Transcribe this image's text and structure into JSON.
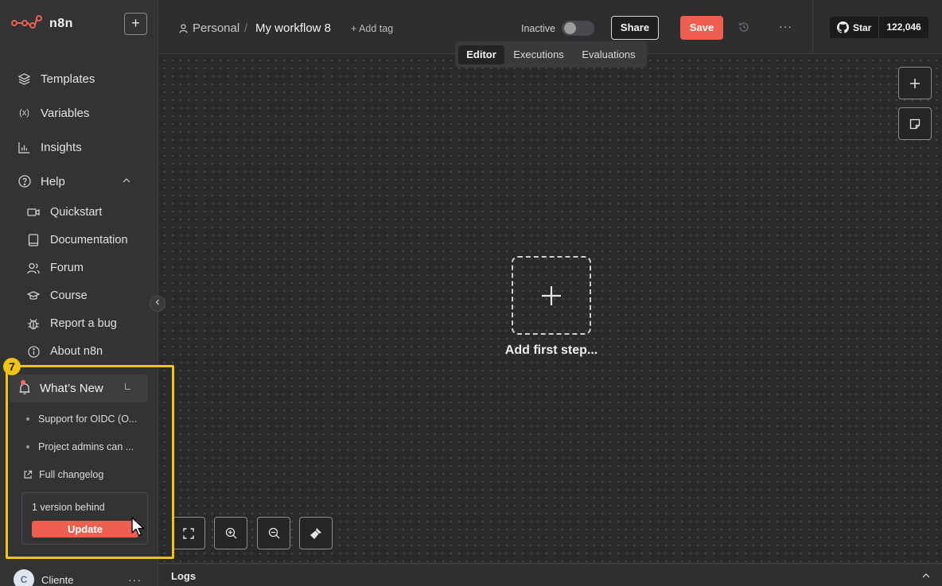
{
  "app": {
    "name": "n8n",
    "accent": "#ef5f4f"
  },
  "sidebar": {
    "add_label": "+",
    "nav": [
      {
        "label": "Templates",
        "icon": "templates-icon"
      },
      {
        "label": "Variables",
        "icon": "variables-icon"
      },
      {
        "label": "Insights",
        "icon": "insights-icon"
      },
      {
        "label": "Help",
        "icon": "help-icon"
      }
    ],
    "help_items": [
      {
        "label": "Quickstart",
        "icon": "video-icon"
      },
      {
        "label": "Documentation",
        "icon": "book-icon"
      },
      {
        "label": "Forum",
        "icon": "users-icon"
      },
      {
        "label": "Course",
        "icon": "graduation-cap-icon"
      },
      {
        "label": "Report a bug",
        "icon": "bug-icon"
      },
      {
        "label": "About n8n",
        "icon": "info-icon"
      }
    ],
    "whats_new": {
      "badge": "7",
      "title": "What’s New",
      "items": [
        "Support for OIDC (O...",
        "Project admins can ..."
      ],
      "changelog_label": "Full changelog",
      "version_text": "1 version behind",
      "update_label": "Update"
    },
    "user": {
      "initial": "C",
      "name": "Cliente"
    }
  },
  "header": {
    "project": "Personal",
    "separator": "/",
    "workflow_name": "My workflow 8",
    "add_tag_label": "+ Add tag",
    "status_label": "Inactive",
    "active": false,
    "share_label": "Share",
    "save_label": "Save",
    "github": {
      "star_label": "Star",
      "count": "122,046"
    }
  },
  "tabs": [
    {
      "label": "Editor",
      "active": true
    },
    {
      "label": "Executions",
      "active": false
    },
    {
      "label": "Evaluations",
      "active": false
    }
  ],
  "canvas": {
    "add_first_step_label": "Add first step..."
  },
  "logs": {
    "label": "Logs"
  }
}
